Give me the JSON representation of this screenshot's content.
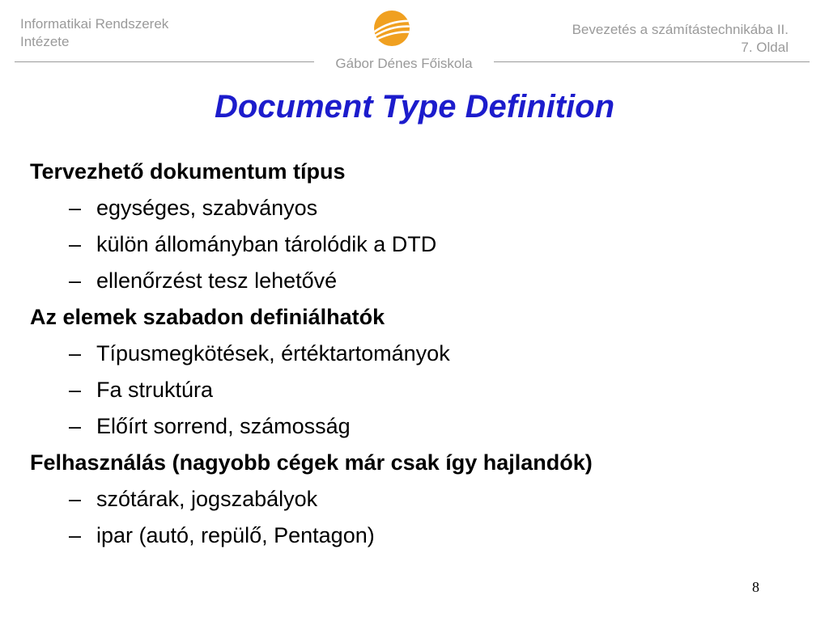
{
  "header": {
    "left_line1": "Informatikai Rendszerek",
    "left_line2": "Intézete",
    "right_line1": "Bevezetés a számítástechnikába II.",
    "right_line2": "7. Oldal",
    "school": "Gábor Dénes Főiskola",
    "logo_icon": "gdf-logo-icon",
    "logo_color": "#f0a020"
  },
  "title": "Document Type Definition",
  "title_color": "#1c1ccc",
  "content": {
    "sections": [
      {
        "heading": "Tervezhető dokumentum típus",
        "items": [
          "egységes, szabványos",
          "külön állományban tárolódik a DTD",
          "ellenőrzést tesz lehetővé"
        ]
      },
      {
        "heading": "Az elemek szabadon definiálhatók",
        "items": [
          "Típusmegkötések, értéktartományok",
          "Fa struktúra",
          "Előírt sorrend, számosság"
        ]
      },
      {
        "heading": "Felhasználás (nagyobb cégek már csak így hajlandók)",
        "items": [
          "szótárak, jogszabályok",
          "ipar (autó, repülő, Pentagon)"
        ]
      }
    ],
    "dash": "–"
  },
  "page_number": "8"
}
